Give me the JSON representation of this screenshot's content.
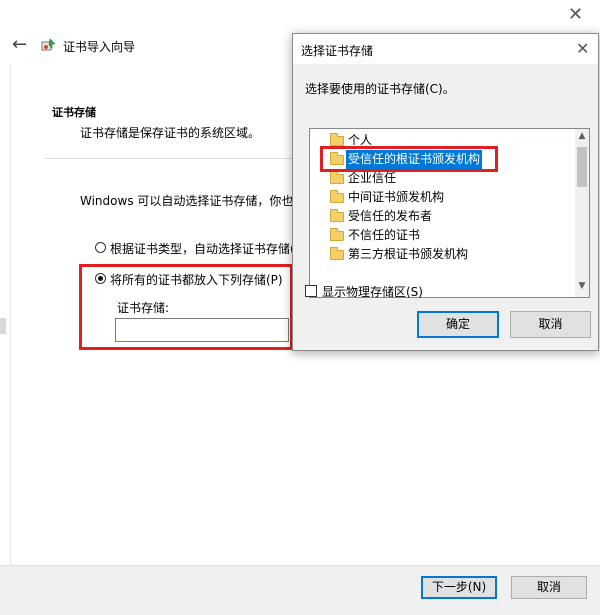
{
  "wizard": {
    "title": "证书导入向导",
    "section_heading": "证书存储",
    "section_desc": "证书存储是保存证书的系统区域。",
    "intro_text": "Windows 可以自动选择证书存储，你也可",
    "radio_auto_label": "根据证书类型，自动选择证书存储(U",
    "radio_manual_label": "将所有的证书都放入下列存储(P)",
    "store_field_label": "证书存储:",
    "store_field_value": "",
    "next_button": "下一步(N)",
    "cancel_button": "取消"
  },
  "dialog": {
    "title": "选择证书存储",
    "prompt": "选择要使用的证书存储(C)。",
    "stores": [
      {
        "label": "个人",
        "selected": false
      },
      {
        "label": "受信任的根证书颁发机构",
        "selected": true
      },
      {
        "label": "企业信任",
        "selected": false
      },
      {
        "label": "中间证书颁发机构",
        "selected": false
      },
      {
        "label": "受信任的发布者",
        "selected": false
      },
      {
        "label": "不信任的证书",
        "selected": false
      },
      {
        "label": "第三方根证书颁发机构",
        "selected": false
      }
    ],
    "show_physical_label": "显示物理存储区(S)",
    "show_physical_checked": false,
    "ok_button": "确定",
    "cancel_button": "取消"
  },
  "colors": {
    "highlight_red": "#e02020",
    "selection_blue": "#0078d7"
  }
}
